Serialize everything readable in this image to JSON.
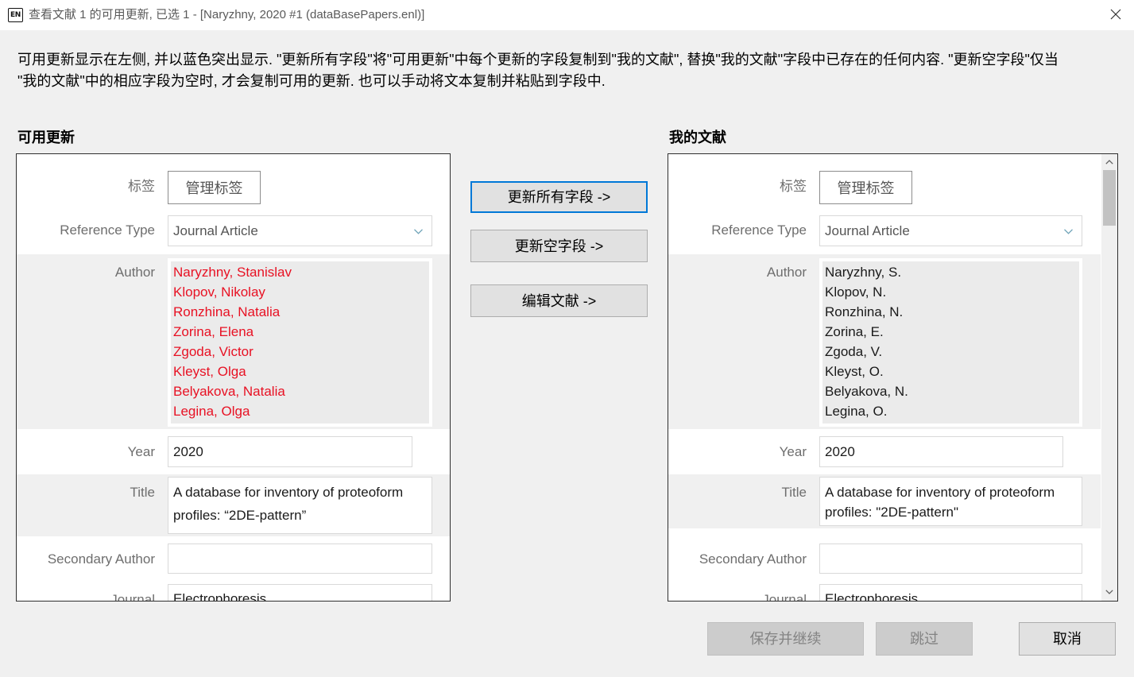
{
  "window": {
    "app_badge": "EN",
    "title": "查看文献 1 的可用更新, 已选 1 - [Naryzhny, 2020 #1 (dataBasePapers.enl)]"
  },
  "instructions": {
    "line1": "可用更新显示在左侧, 并以蓝色突出显示. \"更新所有字段\"将\"可用更新\"中每个更新的字段复制到\"我的文献\", 替换\"我的文献\"字段中已存在的任何内容. \"更新空字段\"仅当",
    "line2": "\"我的文献\"中的相应字段为空时, 才会复制可用的更新. 也可以手动将文本复制并粘贴到字段中."
  },
  "available_updates": {
    "heading": "可用更新",
    "tags_label": "标签",
    "manage_tags_button": "管理标签",
    "reference_type_label": "Reference Type",
    "reference_type_value": "Journal Article",
    "author_label": "Author",
    "authors": [
      "Naryzhny, Stanislav",
      "Klopov, Nikolay",
      "Ronzhina, Natalia",
      "Zorina, Elena",
      "Zgoda, Victor",
      "Kleyst, Olga",
      "Belyakova, Natalia",
      "Legina, Olga"
    ],
    "year_label": "Year",
    "year_value": "2020",
    "title_label": "Title",
    "title_value": "A database for inventory of proteoform profiles: “2DE-pattern”",
    "secondary_author_label": "Secondary Author",
    "secondary_author_value": "",
    "journal_label": "Journal",
    "journal_value": "Electrophoresis"
  },
  "my_reference": {
    "heading": "我的文献",
    "tags_label": "标签",
    "manage_tags_button": "管理标签",
    "reference_type_label": "Reference Type",
    "reference_type_value": "Journal Article",
    "author_label": "Author",
    "authors": [
      "Naryzhny, S.",
      "Klopov, N.",
      "Ronzhina, N.",
      "Zorina, E.",
      "Zgoda, V.",
      "Kleyst, O.",
      "Belyakova, N.",
      "Legina, O."
    ],
    "year_label": "Year",
    "year_value": "2020",
    "title_label": "Title",
    "title_value": "A database for inventory of proteoform profiles: \"2DE-pattern\"",
    "secondary_author_label": "Secondary Author",
    "secondary_author_value": "",
    "journal_label": "Journal",
    "journal_value": "Electrophoresis"
  },
  "transfer_buttons": {
    "update_all_fields": {
      "label": "更新所有字段 ->",
      "focused": true
    },
    "update_empty_fields": {
      "label": "更新空字段 ->",
      "focused": false
    },
    "edit_reference": {
      "label": "编辑文献 ->",
      "focused": false
    }
  },
  "footer_buttons": {
    "save_and_continue": {
      "label": "保存并继续",
      "enabled": false
    },
    "skip": {
      "label": "跳过",
      "enabled": false
    },
    "cancel": {
      "label": "取消",
      "enabled": true
    }
  },
  "icons": {
    "close": "close-icon",
    "dropdown": "chevron-down-icon",
    "scroll_up": "chevron-up-icon",
    "scroll_down": "chevron-down-icon"
  },
  "colors": {
    "updated_field_text": "#e81123",
    "focus_border": "#0078d7",
    "window_background": "#f0f0f0",
    "panel_border": "#2f2f2f",
    "disabled_button_background": "#cccccc",
    "disabled_button_text": "#838383"
  }
}
